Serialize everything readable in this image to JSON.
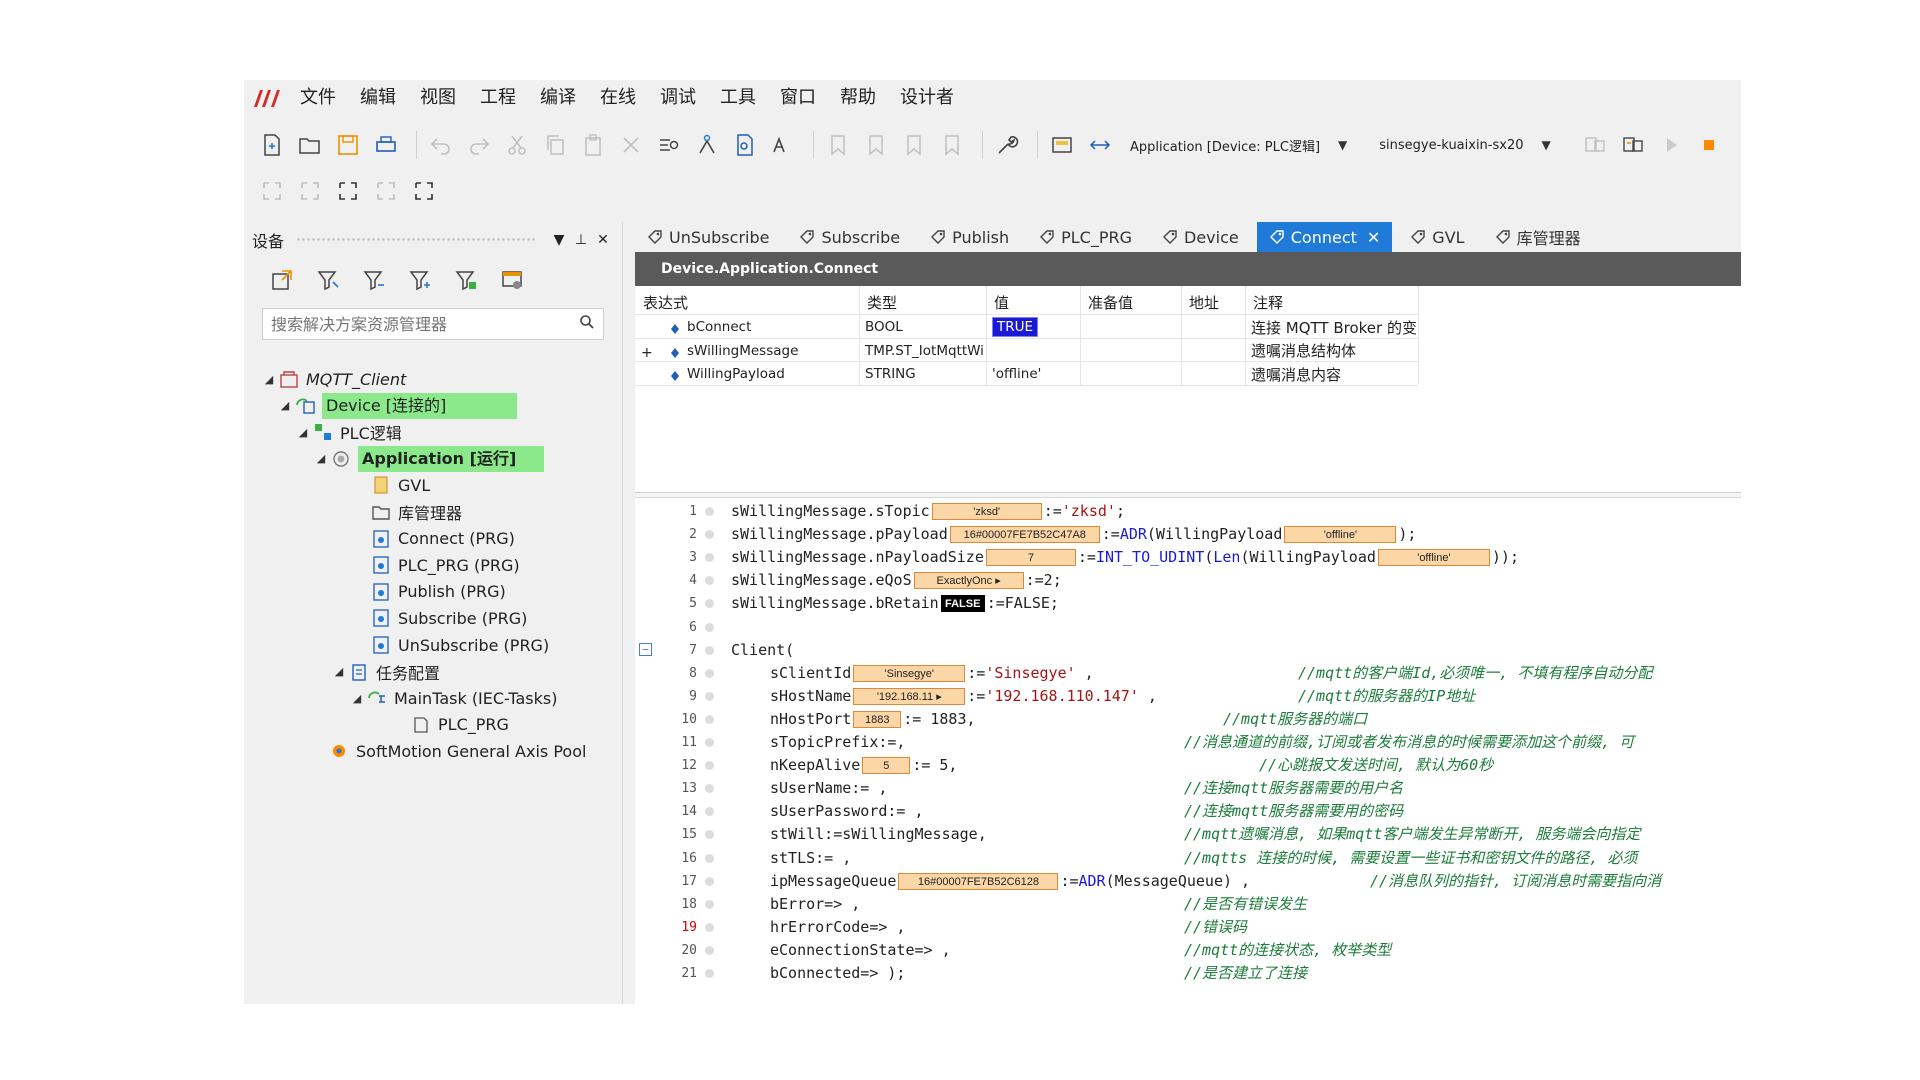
{
  "menu": [
    "文件",
    "编辑",
    "视图",
    "工程",
    "编译",
    "在线",
    "调试",
    "工具",
    "窗口",
    "帮助",
    "设计者"
  ],
  "toolbar": {
    "app_combo": "Application [Device: PLC逻辑]",
    "device_combo": "sinsegye-kuaixin-sx20",
    "colors": {
      "accent": "#1f7ad8",
      "highlight": "#8be98b",
      "logo": "#d42b2b",
      "stop": "#ff8a00"
    }
  },
  "left_panel": {
    "title": "设备",
    "search_placeholder": "搜索解决方案资源管理器",
    "tree": [
      {
        "label": "MQTT_Client",
        "italic": true
      },
      {
        "label": "Device [连接的]",
        "highlight": true
      },
      {
        "label": "PLC逻辑"
      },
      {
        "label": "Application [运行]",
        "highlight": true,
        "bold": true
      },
      {
        "label": "GVL"
      },
      {
        "label": "库管理器"
      },
      {
        "label": "Connect (PRG)"
      },
      {
        "label": "PLC_PRG (PRG)"
      },
      {
        "label": "Publish (PRG)"
      },
      {
        "label": "Subscribe (PRG)"
      },
      {
        "label": "UnSubscribe (PRG)"
      },
      {
        "label": "任务配置"
      },
      {
        "label": "MainTask (IEC-Tasks)"
      },
      {
        "label": "PLC_PRG"
      },
      {
        "label": "SoftMotion General Axis Pool"
      }
    ]
  },
  "tabs": [
    {
      "label": "UnSubscribe"
    },
    {
      "label": "Subscribe"
    },
    {
      "label": "Publish"
    },
    {
      "label": "PLC_PRG"
    },
    {
      "label": "Device"
    },
    {
      "label": "Connect",
      "active": true
    },
    {
      "label": "GVL"
    },
    {
      "label": "库管理器"
    }
  ],
  "editor": {
    "title": "Device.Application.Connect",
    "watch_headers": [
      "表达式",
      "类型",
      "值",
      "准备值",
      "地址",
      "注释"
    ],
    "watch_rows": [
      {
        "expr": "bConnect",
        "type": "BOOL",
        "value": "TRUE",
        "prepared": "",
        "address": "",
        "comment": "连接 MQTT Broker 的变量",
        "expand": ""
      },
      {
        "expr": "sWillingMessage",
        "type": "TMP.ST_IotMqttWill",
        "value": "",
        "prepared": "",
        "address": "",
        "comment": "遗嘱消息结构体",
        "expand": "+"
      },
      {
        "expr": "WillingPayload",
        "type": "STRING",
        "value": "'offline'",
        "prepared": "",
        "address": "",
        "comment": "遗嘱消息内容",
        "expand": ""
      }
    ]
  },
  "code": {
    "lines": [
      {
        "n": "1",
        "pre": "sWillingMessage.sTopic",
        "box": "'zksd'",
        "post": ":='zksd';"
      },
      {
        "n": "2",
        "pre": "sWillingMessage.pPayload",
        "box": "16#00007FE7B52C47A8",
        "post": ":=ADR(WillingPayload",
        "box2": "'offline'",
        "post2": ");"
      },
      {
        "n": "3",
        "pre": "sWillingMessage.nPayloadSize",
        "box": "7",
        "post": ":=INT_TO_UDINT(Len(WillingPayload",
        "box2": "'offline'",
        "post2": "));"
      },
      {
        "n": "4",
        "pre": "sWillingMessage.eQoS",
        "box": "ExactlyOnc ▸",
        "post": ":=2;"
      },
      {
        "n": "5",
        "pre": "sWillingMessage.bRetain",
        "box": "FALSE",
        "post": ":=FALSE;"
      },
      {
        "n": "6",
        "pre": "",
        "post": ""
      },
      {
        "n": "7",
        "pre": "Client(",
        "post": ""
      },
      {
        "n": "8",
        "pre": "sClientId",
        "box": "'Sinsegye'",
        "post": ":='Sinsegye' ,",
        "comment": "//mqtt的客户端Id,必须唯一, 不填有程序自动分配"
      },
      {
        "n": "9",
        "pre": "sHostName",
        "box": "'192.168.11 ▸",
        "post": ":='192.168.110.147' ,",
        "comment": "//mqtt的服务器的IP地址"
      },
      {
        "n": "10",
        "pre": "nHostPort",
        "box": "1883",
        "post": ":= 1883,",
        "comment": "//mqtt服务器的端口"
      },
      {
        "n": "11",
        "pre": "sTopicPrefix:=,",
        "post": "",
        "comment": "//消息通道的前缀,订阅或者发布消息的时候需要添加这个前缀, 可"
      },
      {
        "n": "12",
        "pre": "nKeepAlive",
        "box": "5",
        "post": ":= 5,",
        "comment": "//心跳报文发送时间, 默认为60秒"
      },
      {
        "n": "13",
        "pre": "sUserName:= ,",
        "post": "",
        "comment": "//连接mqtt服务器需要的用户名"
      },
      {
        "n": "14",
        "pre": "sUserPassword:= ,",
        "post": "",
        "comment": "//连接mqtt服务器需要用的密码"
      },
      {
        "n": "15",
        "pre": "stWill:=sWillingMessage,",
        "post": "",
        "comment": "//mqtt遗嘱消息, 如果mqtt客户端发生异常断开, 服务端会向指定"
      },
      {
        "n": "16",
        "pre": "stTLS:= ,",
        "post": "",
        "comment": "//mqtts 连接的时候, 需要设置一些证书和密钥文件的路径, 必须"
      },
      {
        "n": "17",
        "pre": "ipMessageQueue",
        "box": "16#00007FE7B52C6128",
        "post": ":=ADR(MessageQueue) ,",
        "comment": "//消息队列的指针, 订阅消息时需要指向消"
      },
      {
        "n": "18",
        "pre": "bError=> ,",
        "post": "",
        "comment": "//是否有错误发生"
      },
      {
        "n": "19",
        "pre": "hrErrorCode=> ,",
        "post": "",
        "comment": "//错误码",
        "red": true
      },
      {
        "n": "20",
        "pre": "eConnectionState=> ,",
        "post": "",
        "comment": "//mqtt的连接状态, 枚举类型"
      },
      {
        "n": "21",
        "pre": "bConnected=> );",
        "post": "",
        "comment": "//是否建立了连接"
      }
    ]
  }
}
